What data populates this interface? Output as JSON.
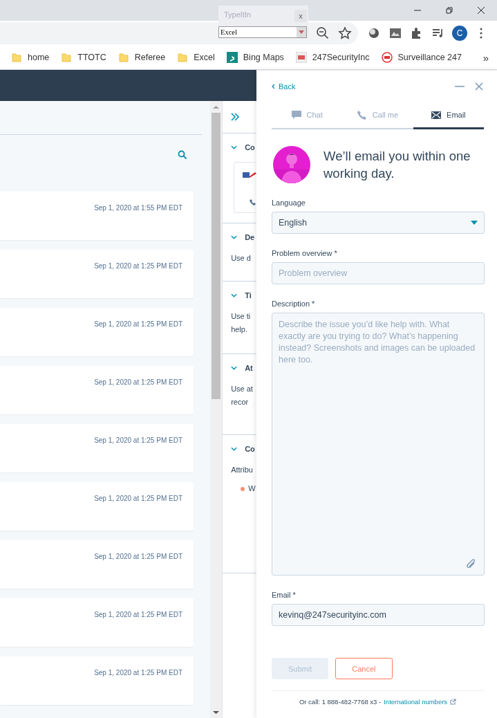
{
  "browser": {
    "popup": {
      "title": "TypeItIn",
      "close": "x",
      "value": "Excel"
    },
    "profile_letter": "C",
    "bookmarks": [
      {
        "label": "home",
        "kind": "folder"
      },
      {
        "label": "TTOTC",
        "kind": "folder"
      },
      {
        "label": "Referee",
        "kind": "folder"
      },
      {
        "label": "Excel",
        "kind": "folder"
      },
      {
        "label": "Bing Maps",
        "kind": "bing"
      },
      {
        "label": "247SecurityInc",
        "kind": "site"
      },
      {
        "label": "Surveillance 247",
        "kind": "badge"
      }
    ],
    "more": "»"
  },
  "activity": {
    "cards": [
      {
        "date": "Sep 1, 2020 at 1:55 PM EDT"
      },
      {
        "date": "Sep 1, 2020 at 1:25 PM EDT"
      },
      {
        "date": "Sep 1, 2020 at 1:25 PM EDT"
      },
      {
        "date": "Sep 1, 2020 at 1:25 PM EDT"
      },
      {
        "date": "Sep 1, 2020 at 1:25 PM EDT"
      },
      {
        "date": "Sep 1, 2020 at 1:25 PM EDT"
      },
      {
        "date": "Sep 1, 2020 at 1:25 PM EDT"
      },
      {
        "date": "Sep 1, 2020 at 1:25 PM EDT"
      },
      {
        "date": "Sep 1, 2020 at 1:25 PM EDT"
      }
    ]
  },
  "sidebar": {
    "sections": [
      {
        "title": "Co",
        "kind": "contact"
      },
      {
        "title": "De",
        "kind": "text",
        "lines": [
          "Use d"
        ]
      },
      {
        "title": "Ti",
        "kind": "text",
        "lines": [
          "Use ti",
          "help."
        ]
      },
      {
        "title": "At",
        "kind": "text",
        "lines": [
          "Use at",
          "recor"
        ]
      },
      {
        "title": "Co",
        "kind": "attribution",
        "lines": [
          "Attribu"
        ],
        "item": "W"
      }
    ]
  },
  "help_panel": {
    "back": "Back",
    "tabs": [
      {
        "label": "Chat",
        "kind": "chat",
        "selected": false
      },
      {
        "label": "Call me",
        "kind": "phone",
        "selected": false
      },
      {
        "label": "Email",
        "kind": "email",
        "selected": true
      }
    ],
    "heading": "We’ll email you within one working day.",
    "fields": [
      {
        "kind": "select",
        "label": "Language",
        "value": "English"
      },
      {
        "kind": "input",
        "label": "Problem overview *",
        "placeholder": "Problem overview"
      },
      {
        "kind": "textarea",
        "label": "Description *",
        "placeholder": "Describe the issue you’d like help with. What exactly are you trying to do? What’s happening instead? Screenshots and images can be uploaded here too."
      },
      {
        "kind": "input",
        "label": "Email *",
        "value": "kevinq@247securityinc.com"
      }
    ],
    "submit": {
      "label": "Submit",
      "disabled": true
    },
    "cancel": "Cancel",
    "footer": {
      "text": "Or call: 1 888-482-7768 x3 -",
      "link": "International numbers"
    }
  }
}
